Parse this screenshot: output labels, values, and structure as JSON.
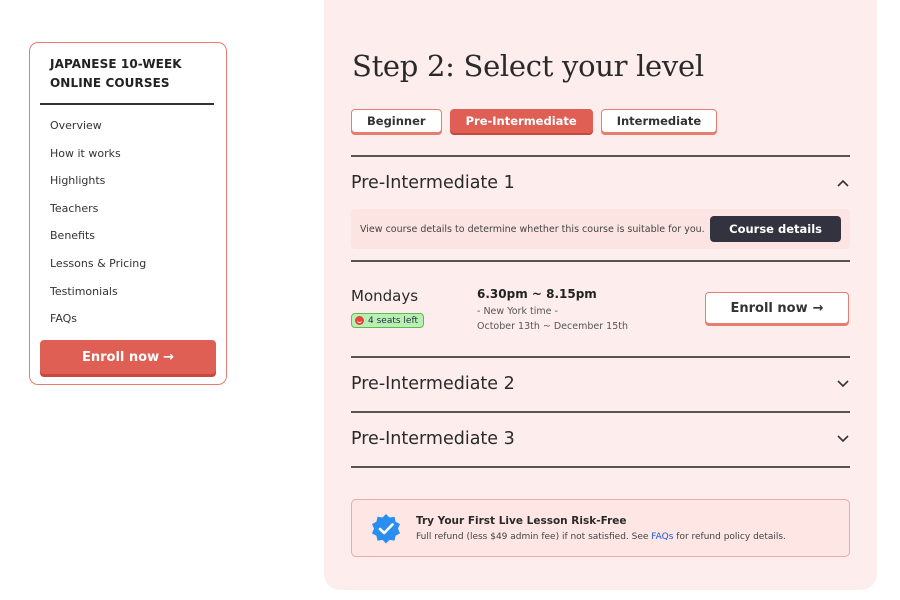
{
  "sidebar": {
    "title": "JAPANESE 10-WEEK\nONLINE COURSES",
    "items": [
      {
        "label": "Overview"
      },
      {
        "label": "How it works"
      },
      {
        "label": "Highlights"
      },
      {
        "label": "Teachers"
      },
      {
        "label": "Benefits"
      },
      {
        "label": "Lessons & Pricing"
      },
      {
        "label": "Testimonials"
      },
      {
        "label": "FAQs"
      }
    ],
    "enroll_label": "Enroll now",
    "enroll_arrow": "→"
  },
  "main": {
    "step_title": "Step 2: Select your level",
    "levels": [
      {
        "label": "Beginner",
        "active": false
      },
      {
        "label": "Pre-Intermediate",
        "active": true
      },
      {
        "label": "Intermediate",
        "active": false
      }
    ],
    "courses": [
      {
        "title": "Pre-Intermediate 1",
        "expanded": true,
        "details_text": "View course details to determine whether this course is suitable for you.",
        "details_button": "Course details",
        "session": {
          "day": "Mondays",
          "seats": "4 seats left",
          "time": "6.30pm ~ 8.15pm",
          "timezone": "- New York time -",
          "dates": "October 13th ~ December 15th",
          "enroll_label": "Enroll now",
          "enroll_arrow": "→"
        }
      },
      {
        "title": "Pre-Intermediate 2",
        "expanded": false
      },
      {
        "title": "Pre-Intermediate 3",
        "expanded": false
      }
    ],
    "promo": {
      "title": "Try Your First Live Lesson Risk-Free",
      "text_before": "Full refund (less $49 admin fee) if not satisfied. See ",
      "link": "FAQs",
      "text_after": " for refund policy details."
    }
  },
  "colors": {
    "accent": "#df5f55",
    "panel_bg": "#fdeeed",
    "dark_button": "#33333f",
    "seats_green": "#b9efb3",
    "verified_blue": "#2a8ef0"
  },
  "icons": {
    "collapse": "chevron-up-icon",
    "expand": "chevron-down-icon",
    "promo": "verified-badge-icon",
    "seats": "smile-icon"
  }
}
